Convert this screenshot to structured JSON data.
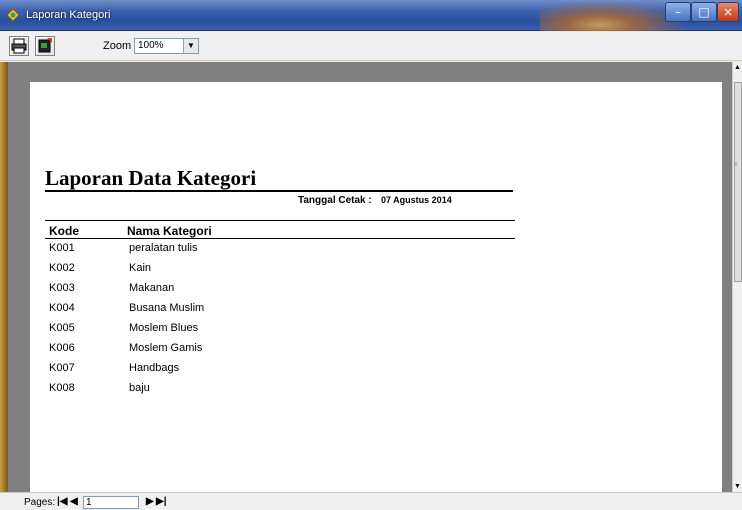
{
  "window": {
    "title": "Laporan Kategori"
  },
  "toolbar": {
    "zoom_label": "Zoom",
    "zoom_value": "100%"
  },
  "report": {
    "title": "Laporan Data Kategori",
    "date_label": "Tanggal Cetak :",
    "date_value": "07 Agustus 2014",
    "columns": [
      "Kode",
      "Nama Kategori"
    ],
    "rows": [
      {
        "kode": "K001",
        "nama": "peralatan tulis"
      },
      {
        "kode": "K002",
        "nama": "Kain"
      },
      {
        "kode": "K003",
        "nama": "Makanan"
      },
      {
        "kode": "K004",
        "nama": "Busana Muslim"
      },
      {
        "kode": "K005",
        "nama": "Moslem Blues"
      },
      {
        "kode": "K006",
        "nama": "Moslem Gamis"
      },
      {
        "kode": "K007",
        "nama": "Handbags"
      },
      {
        "kode": "K008",
        "nama": "baju"
      }
    ]
  },
  "pager": {
    "label": "Pages:",
    "current": "1"
  }
}
